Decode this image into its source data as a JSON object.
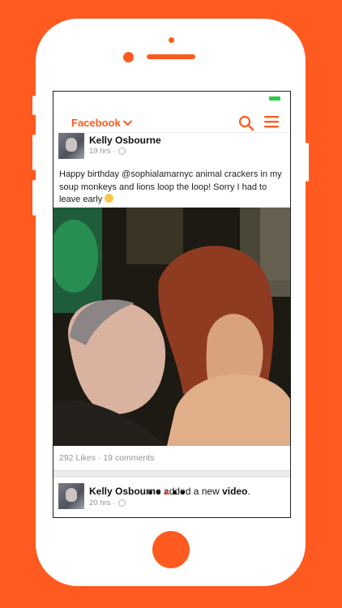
{
  "app": {
    "title": "Facebook"
  },
  "post1": {
    "author": "Kelly Osbourne",
    "time": "19 hrs",
    "dot_sep": "·",
    "text": "Happy birthday @sophialamarnyc animal crackers in my soup monkeys and lions loop the loop! Sorry I had to leave early",
    "likes": "292 Likes",
    "comments": "19 comments"
  },
  "post2": {
    "author": "Kelly Osbourne",
    "action_mid": " added a new ",
    "action_obj": "video",
    "action_end": ".",
    "time": "20 hrs",
    "dot_sep": "·"
  },
  "icons": {
    "dropdown": "chevron-down-icon",
    "search": "search-icon",
    "menu": "hamburger-menu-icon",
    "privacy": "globe-icon",
    "emoji": "smiley-emoji-icon",
    "loading": "loading-dots"
  },
  "colors": {
    "accent": "#FF5A1F",
    "battery": "#2ECC40",
    "secondary_text": "#90949c"
  }
}
